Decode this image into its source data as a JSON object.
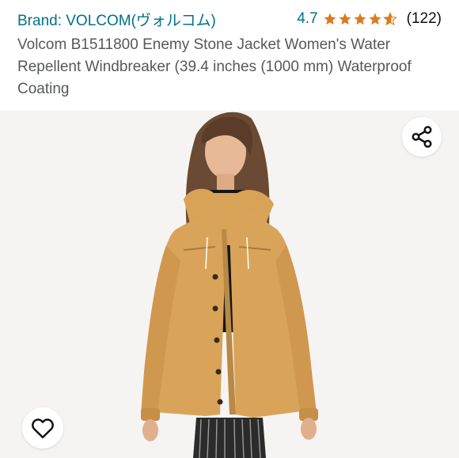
{
  "header": {
    "brand_label": "Brand: VOLCOM(ヴォルコム)",
    "rating_value": "4.7",
    "rating_stars": 4.7,
    "review_count": "(122)",
    "product_title": "Volcom B1511800 Enemy Stone Jacket Women's Water Repellent Windbreaker (39.4 inches (1000 mm) Waterproof Coating"
  },
  "icons": {
    "share": "share-icon",
    "wishlist": "heart-icon",
    "star": "star-icon"
  },
  "colors": {
    "link": "#007185",
    "star": "#de7921",
    "jacket": "#d9a45a",
    "background": "#f5f4f2"
  }
}
